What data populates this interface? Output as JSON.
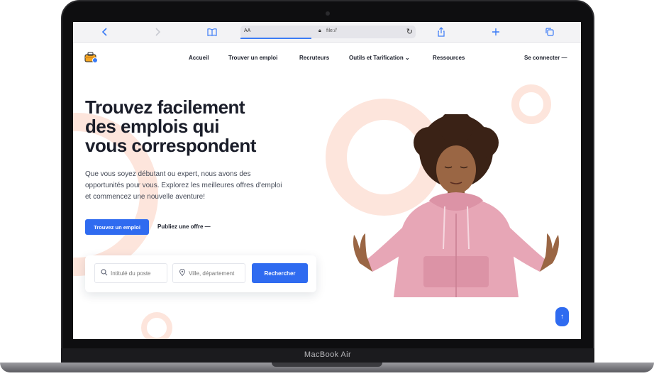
{
  "device": {
    "brand": "MacBook Air"
  },
  "browser": {
    "address_aa": "AA",
    "url": "file://"
  },
  "nav": {
    "items": [
      "Accueil",
      "Trouver un emploi",
      "Recruteurs",
      "Outils et Tarification",
      "Ressources"
    ],
    "login": "Se connecter —"
  },
  "hero": {
    "title_lines": [
      "Trouvez facilement",
      "des emplois qui",
      "vous correspondent"
    ],
    "description_lines": [
      "Que vous soyez débutant ou expert, nous avons des",
      "opportunités pour vous. Explorez les meilleures offres d'emploi",
      "et commencez une nouvelle aventure!"
    ],
    "primary_button": "Trouvez un emploi",
    "secondary_link": "Publiez une offre —"
  },
  "search": {
    "job_placeholder": "Intitulé du poste",
    "city_placeholder": "Ville, département",
    "button": "Rechercher"
  },
  "colors": {
    "accent": "#2f6bf0",
    "decor_ring": "#fde5dc",
    "text_dark": "#1a1d29"
  },
  "icons": {
    "back": "chevron-left-icon",
    "forward": "chevron-right-icon",
    "bookmarks": "book-icon",
    "share": "share-icon",
    "new_tab": "plus-icon",
    "tabs": "tabs-icon",
    "scroll_top": "arrow-up-icon"
  }
}
